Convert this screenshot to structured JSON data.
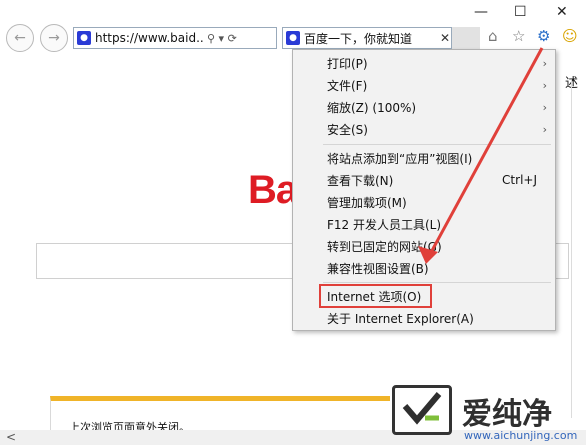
{
  "window_controls": {
    "minimize": "—",
    "maximize": "☐",
    "close": "✕"
  },
  "toolbar": {
    "back_icon": "back-arrow-icon",
    "forward_icon": "forward-arrow-icon",
    "address_url": "https://www.baid...",
    "address_tools": "⚲ ▾ ⟳",
    "tab_title": "百度一下，你就知道",
    "tab_close": "✕",
    "home_icon": "⌂",
    "favorites_icon": "☆",
    "tools_icon": "⚙",
    "smile_icon": "☺"
  },
  "page": {
    "logo_text": "Ba",
    "edge_text": "述",
    "restore_notice": "上次浏览页面意外关闭。",
    "scroll_left": "<"
  },
  "menu": {
    "items": [
      {
        "label": "打印(P)",
        "accel": "",
        "submenu": true
      },
      {
        "label": "文件(F)",
        "accel": "",
        "submenu": true
      },
      {
        "label": "缩放(Z) (100%)",
        "accel": "",
        "submenu": true
      },
      {
        "label": "安全(S)",
        "accel": "",
        "submenu": true
      },
      {
        "label": "将站点添加到“应用”视图(I)",
        "accel": "",
        "submenu": false
      },
      {
        "label": "查看下载(N)",
        "accel": "Ctrl+J",
        "submenu": false
      },
      {
        "label": "管理加载项(M)",
        "accel": "",
        "submenu": false
      },
      {
        "label": "F12 开发人员工具(L)",
        "accel": "",
        "submenu": false
      },
      {
        "label": "转到已固定的网站(G)",
        "accel": "",
        "submenu": false
      },
      {
        "label": "兼容性视图设置(B)",
        "accel": "",
        "submenu": false
      },
      {
        "label": "Internet 选项(O)",
        "accel": "",
        "submenu": false
      },
      {
        "label": "关于 Internet Explorer(A)",
        "accel": "",
        "submenu": false
      }
    ],
    "submenu_glyph": "›"
  },
  "watermark": {
    "brand": "爱纯净",
    "url": "www.aichunjing.com"
  },
  "colors": {
    "annotation_red": "#e0403a",
    "baidu_red": "#de1c24",
    "favicon_blue": "#2a3bd6"
  }
}
